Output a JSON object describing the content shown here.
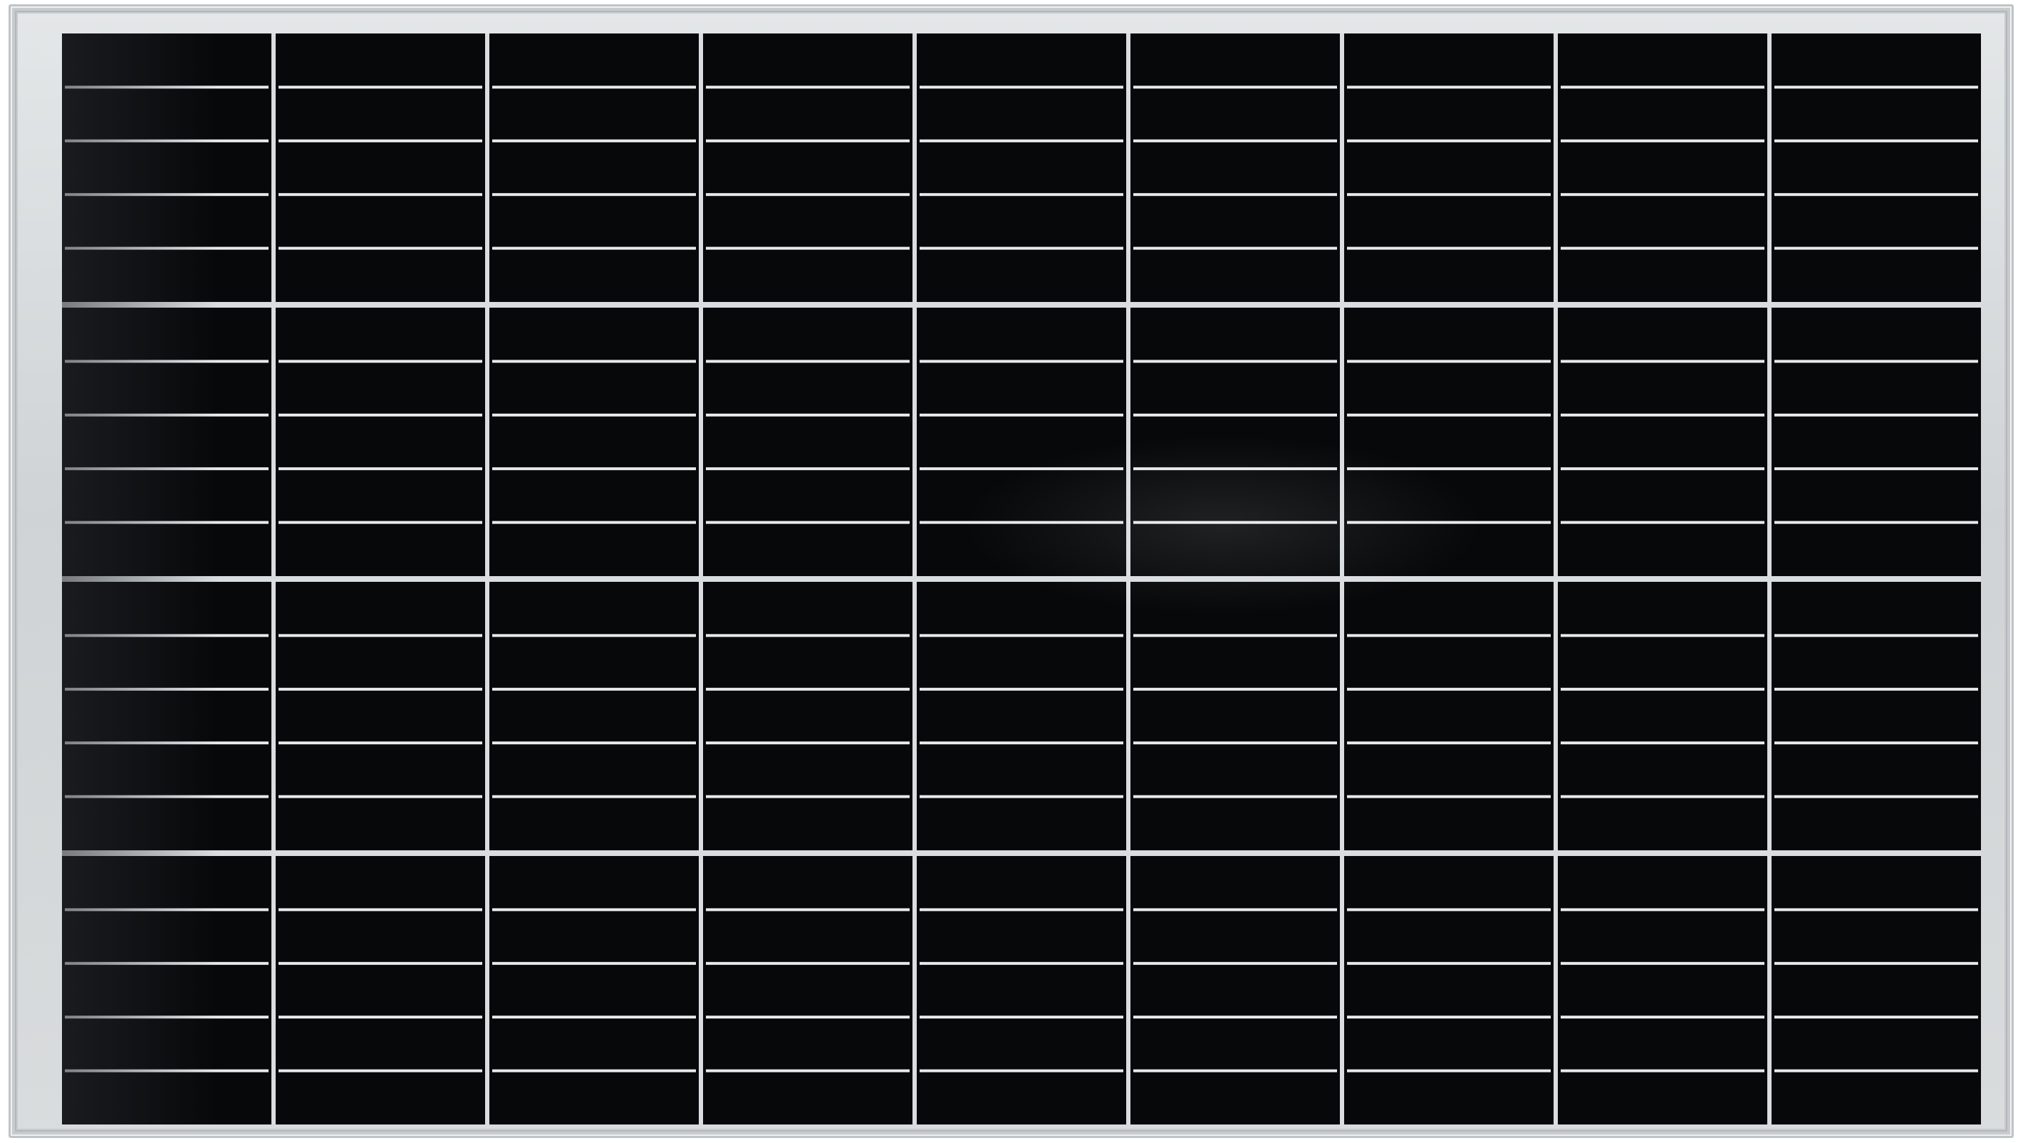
{
  "panel": {
    "columns": 9,
    "groups": 4,
    "strips_per_group": 5,
    "colors": {
      "frame": "#d6d9db",
      "cell": "#070809",
      "busbar": "#e8ebec",
      "grid": "#d9dddf"
    }
  }
}
